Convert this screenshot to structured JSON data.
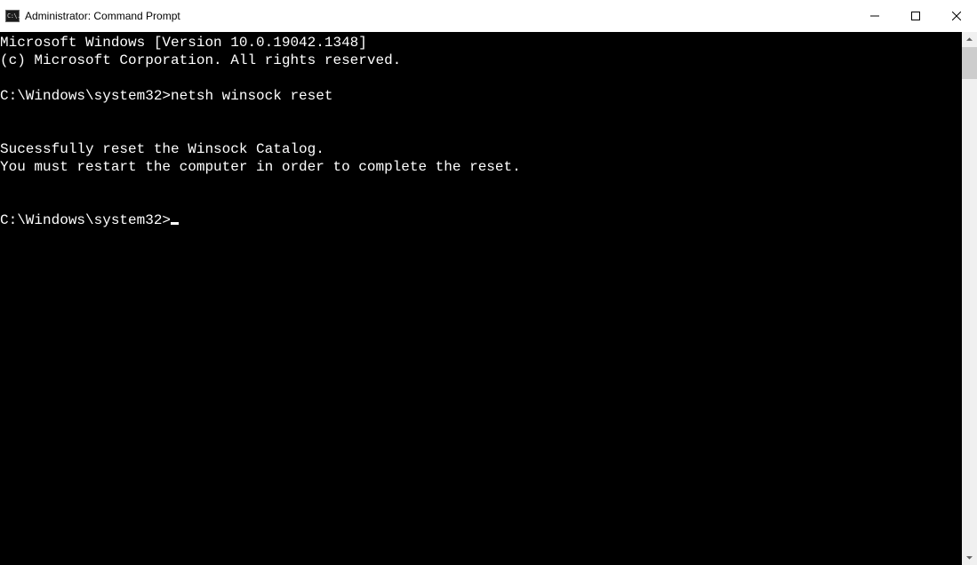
{
  "window": {
    "title": "Administrator: Command Prompt"
  },
  "terminal": {
    "lines": [
      "Microsoft Windows [Version 10.0.19042.1348]",
      "(c) Microsoft Corporation. All rights reserved.",
      "",
      "C:\\Windows\\system32>netsh winsock reset",
      "",
      "",
      "Sucessfully reset the Winsock Catalog.",
      "You must restart the computer in order to complete the reset.",
      "",
      "",
      "C:\\Windows\\system32>"
    ],
    "cursor_line_index": 10
  }
}
